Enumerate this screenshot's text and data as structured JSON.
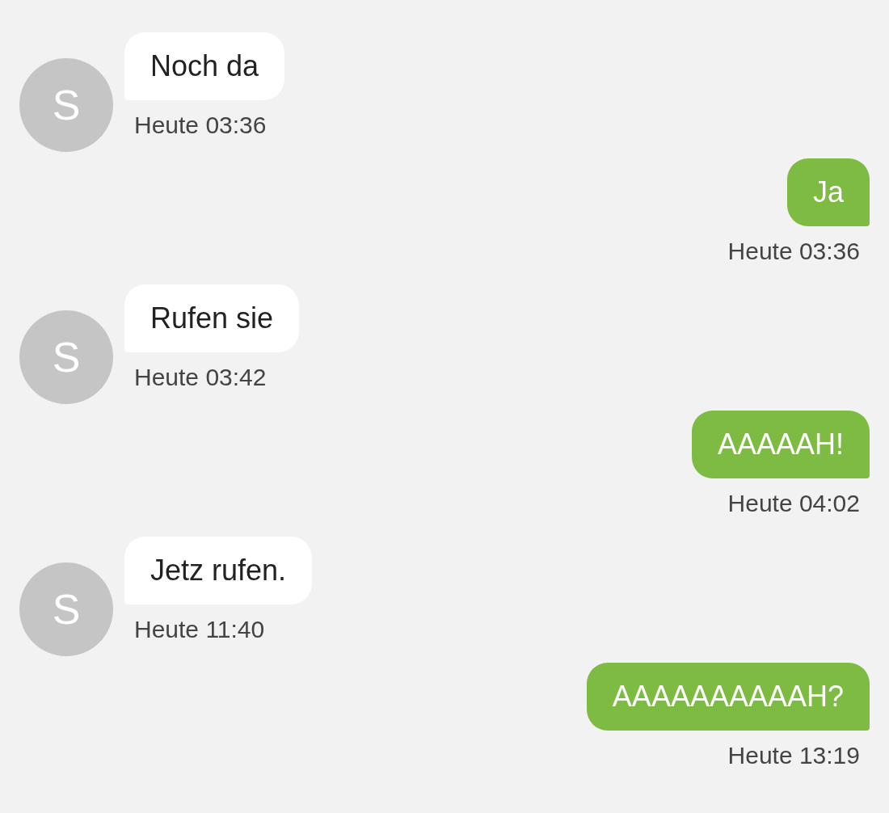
{
  "messages": [
    {
      "kind": "incoming",
      "avatar": "S",
      "text": "Noch da",
      "time": "Heute 03:36"
    },
    {
      "kind": "outgoing",
      "text": "Ja",
      "time": "Heute 03:36"
    },
    {
      "kind": "incoming",
      "avatar": "S",
      "text": "Rufen sie",
      "time": "Heute 03:42"
    },
    {
      "kind": "outgoing",
      "text": "AAAAAH!",
      "time": "Heute 04:02"
    },
    {
      "kind": "incoming",
      "avatar": "S",
      "text": "Jetz rufen.",
      "time": "Heute 11:40"
    },
    {
      "kind": "outgoing",
      "text": "AAAAAAAAAAH?",
      "time": "Heute 13:19"
    }
  ]
}
